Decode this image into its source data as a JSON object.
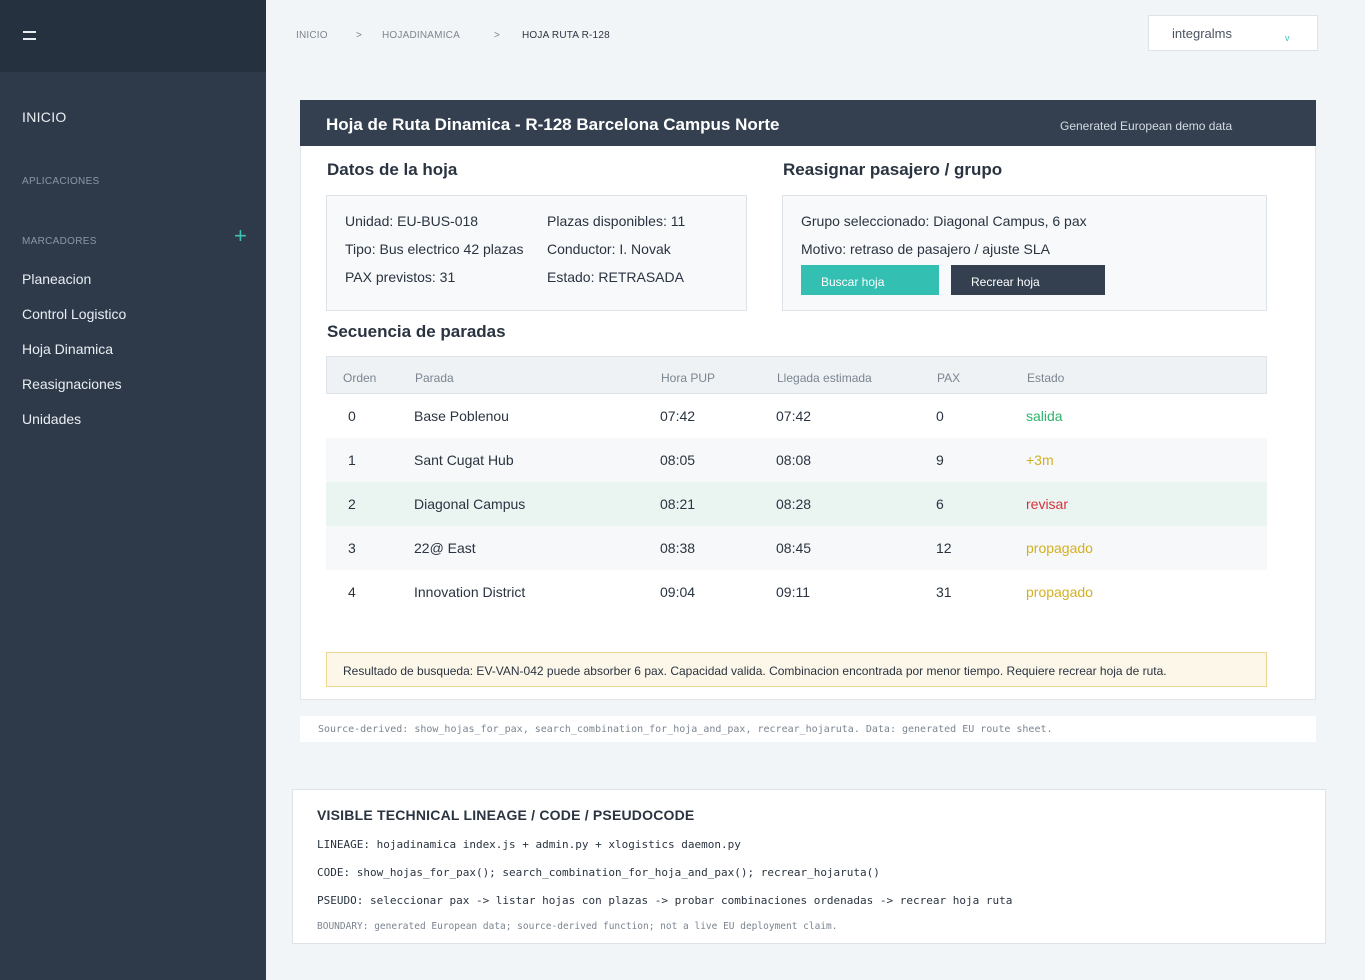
{
  "sidebar": {
    "home": "INICIO",
    "apps_section": "APLICACIONES",
    "bookmarks_section": "MARCADORES",
    "add_icon": "+",
    "items": [
      {
        "label": "Planeacion"
      },
      {
        "label": "Control Logistico"
      },
      {
        "label": "Hoja Dinamica"
      },
      {
        "label": "Reasignaciones"
      },
      {
        "label": "Unidades"
      }
    ]
  },
  "header": {
    "breadcrumb": [
      "INICIO",
      ">",
      "HOJADINAMICA",
      ">",
      "HOJA RUTA R-128"
    ],
    "user": "integralms",
    "user_caret": "v"
  },
  "card": {
    "title": "Hoja de Ruta Dinamica - R-128 Barcelona Campus Norte",
    "note": "Generated European demo data"
  },
  "sheet": {
    "heading": "Datos de la hoja",
    "unit": "Unidad: EU-BUS-018",
    "type": "Tipo: Bus electrico 42 plazas",
    "pax": "PAX previstos: 31",
    "seats": "Plazas disponibles: 11",
    "driver": "Conductor: I. Novak",
    "status": "Estado: RETRASADA"
  },
  "reassign": {
    "heading": "Reasignar pasajero / grupo",
    "group": "Grupo seleccionado: Diagonal Campus, 6 pax",
    "reason": "Motivo: retraso de pasajero / ajuste SLA",
    "search_btn": "Buscar hoja",
    "recreate_btn": "Recrear hoja"
  },
  "stops": {
    "heading": "Secuencia de paradas",
    "columns": [
      "Orden",
      "Parada",
      "Hora PUP",
      "Llegada estimada",
      "PAX",
      "Estado"
    ],
    "rows": [
      {
        "order": "0",
        "stop": "Base Poblenou",
        "pup": "07:42",
        "eta": "07:42",
        "pax": "0",
        "status": "salida"
      },
      {
        "order": "1",
        "stop": "Sant Cugat Hub",
        "pup": "08:05",
        "eta": "08:08",
        "pax": "9",
        "status": "+3m"
      },
      {
        "order": "2",
        "stop": "Diagonal Campus",
        "pup": "08:21",
        "eta": "08:28",
        "pax": "6",
        "status": "revisar"
      },
      {
        "order": "3",
        "stop": "22@ East",
        "pup": "08:38",
        "eta": "08:45",
        "pax": "12",
        "status": "propagado"
      },
      {
        "order": "4",
        "stop": "Innovation District",
        "pup": "09:04",
        "eta": "09:11",
        "pax": "31",
        "status": "propagado"
      }
    ]
  },
  "result": "Resultado de busqueda: EV-VAN-042 puede absorber 6 pax. Capacidad valida. Combinacion encontrada por menor tiempo. Requiere recrear hoja de ruta.",
  "source": "Source-derived: show_hojas_for_pax, search_combination_for_hoja_and_pax, recrear_hojaruta. Data: generated EU route sheet.",
  "lineage": {
    "title": "VISIBLE TECHNICAL LINEAGE / CODE / PSEUDOCODE",
    "lineage": "LINEAGE: hojadinamica index.js + admin.py + xlogistics daemon.py",
    "code": "CODE: show_hojas_for_pax(); search_combination_for_hoja_and_pax(); recrear_hojaruta()",
    "pseudo": "PSEUDO: seleccionar pax -> listar hojas con plazas -> probar combinaciones ordenadas -> recrear hoja ruta",
    "boundary": "BOUNDARY: generated European data; source-derived function; not a live EU deployment claim."
  },
  "colors": {
    "sidebar": "#2e3a4a",
    "accent": "#33bfb1",
    "header_bar": "#34404f",
    "status_ok": "#2db46a",
    "status_warn": "#d4b021",
    "status_error": "#d8313b"
  }
}
